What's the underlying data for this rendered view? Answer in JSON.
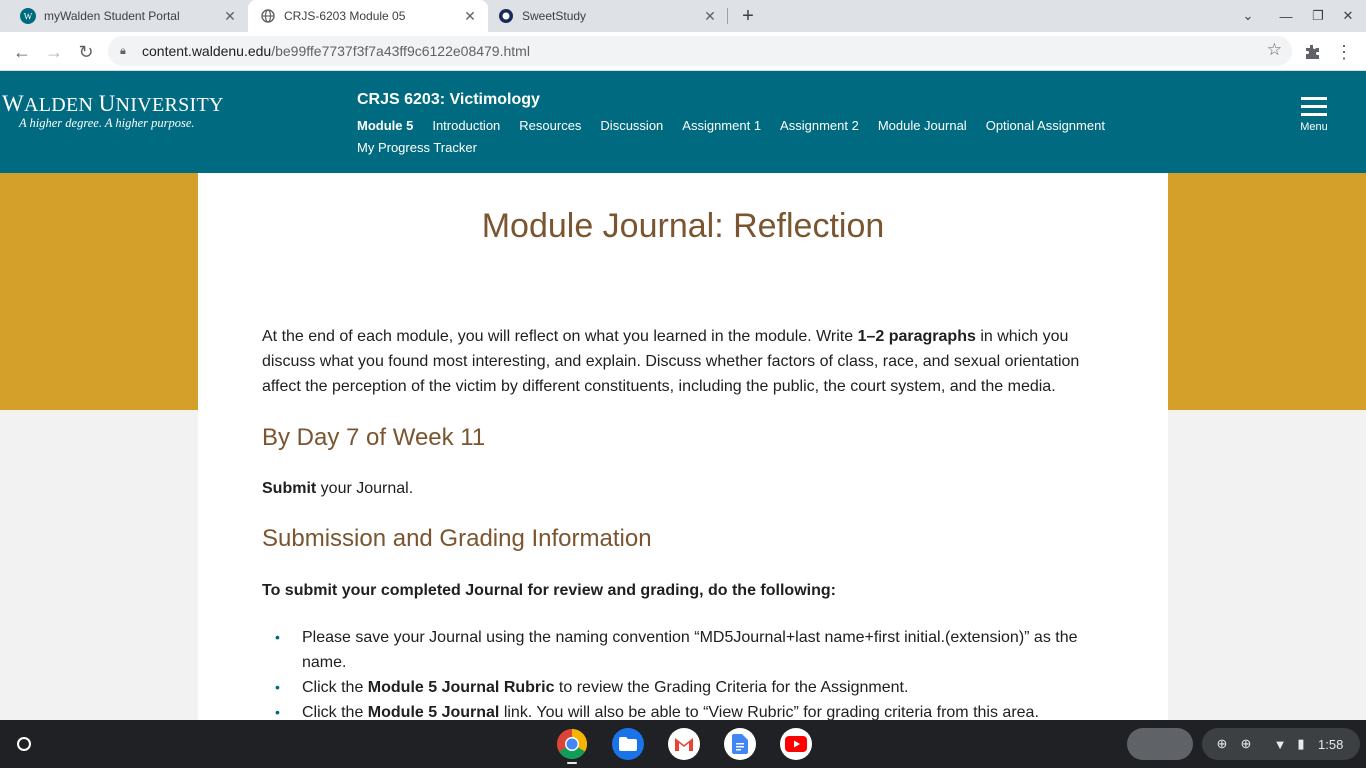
{
  "browser": {
    "tabs": [
      {
        "title": "myWalden Student Portal",
        "favicon": "walden-w-icon",
        "active": false
      },
      {
        "title": "CRJS-6203 Module 05",
        "favicon": "globe-icon",
        "active": true
      },
      {
        "title": "SweetStudy",
        "favicon": "sweetstudy-icon",
        "active": false
      }
    ],
    "url_host": "content.waldenu.edu",
    "url_path": "/be99ffe7737f3f7a43ff9c6122e08479.html"
  },
  "site": {
    "logo_name_first": "W",
    "logo_name_rest": "ALDEN ",
    "logo_name_first2": "U",
    "logo_name_rest2": "NIVERSITY",
    "logo_tagline": "A higher degree. A higher purpose.",
    "course_title": "CRJS 6203: Victimology",
    "module_nav": [
      "Module 5",
      "Introduction",
      "Resources",
      "Discussion",
      "Assignment 1",
      "Assignment 2",
      "Module Journal",
      "Optional Assignment",
      "My Progress Tracker"
    ],
    "menu_label": "Menu",
    "header_color": "#006b80",
    "accent_gold": "#d4a02a"
  },
  "content": {
    "title": "Module Journal: Reflection",
    "intro_before": "At the end of each module, you will reflect on what you learned in the module. Write ",
    "intro_bold": "1–2 paragraphs",
    "intro_after": " in which you discuss what you found most interesting, and explain. Discuss whether factors of class, race, and sexual orientation affect the perception of the victim by different constituents, including the public, the court system, and the media.",
    "due_heading": "By Day 7 of Week 11",
    "submit_bold": "Submit",
    "submit_rest": " your Journal.",
    "grading_heading": "Submission and Grading Information",
    "grading_instructions": "To submit your completed Journal for review and grading, do the following:",
    "steps": [
      {
        "before": "Please save your Journal using the naming convention “MD5Journal+last name+first initial.(extension)” as the name.",
        "bold": "",
        "after": ""
      },
      {
        "before": "Click the ",
        "bold": "Module 5 Journal Rubric",
        "after": " to review the Grading Criteria for the Assignment."
      },
      {
        "before": "Click the ",
        "bold": "Module 5 Journal",
        "after": " link. You will also be able to “View Rubric” for grading criteria from this area."
      }
    ]
  },
  "shelf": {
    "apps": [
      "chrome-icon",
      "files-icon",
      "gmail-icon",
      "docs-icon",
      "youtube-icon"
    ],
    "time": "1:58"
  }
}
